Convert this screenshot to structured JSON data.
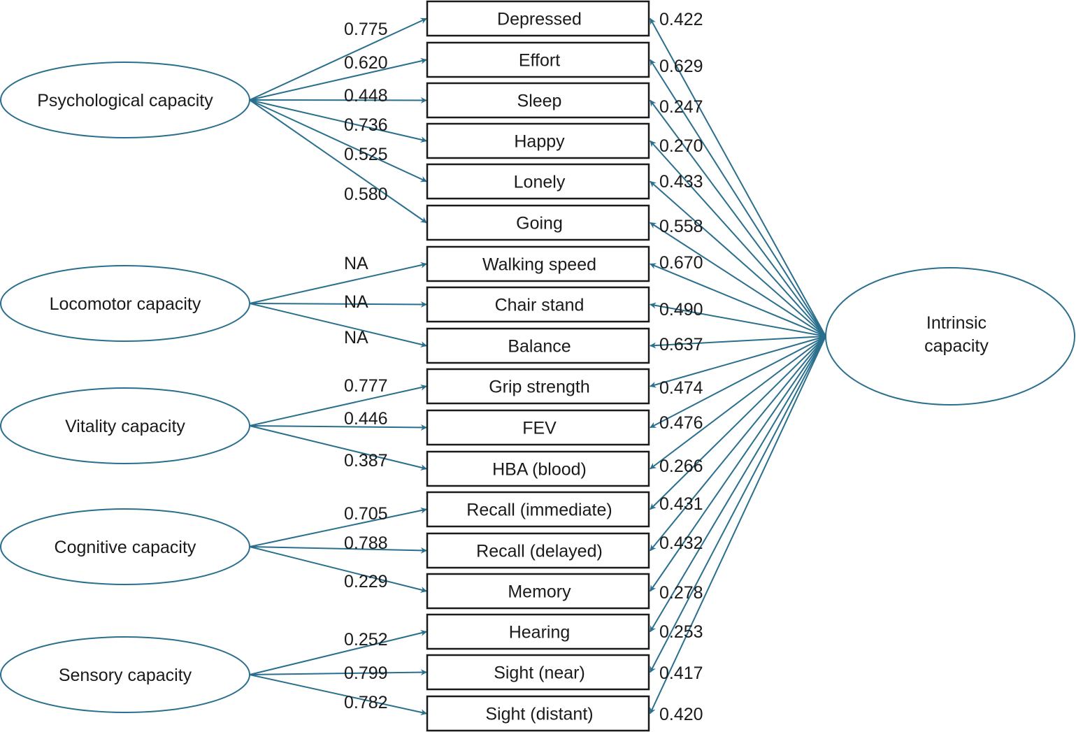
{
  "diagram": {
    "type": "structural-equation-model",
    "edge_color": "#2a6f8d",
    "latent_factors": [
      {
        "id": "psych",
        "label": "Psychological capacity"
      },
      {
        "id": "loco",
        "label": "Locomotor capacity"
      },
      {
        "id": "vital",
        "label": "Vitality capacity"
      },
      {
        "id": "cog",
        "label": "Cognitive capacity"
      },
      {
        "id": "sens",
        "label": "Sensory capacity"
      }
    ],
    "general_factor": {
      "label_line1": "Intrinsic",
      "label_line2": "capacity"
    },
    "indicators": [
      {
        "label": "Depressed",
        "factor": "psych",
        "domain_loading": "0.775",
        "general_loading": "0.422"
      },
      {
        "label": "Effort",
        "factor": "psych",
        "domain_loading": "0.620",
        "general_loading": "0.629"
      },
      {
        "label": "Sleep",
        "factor": "psych",
        "domain_loading": "0.448",
        "general_loading": "0.247"
      },
      {
        "label": "Happy",
        "factor": "psych",
        "domain_loading": "0.736",
        "general_loading": "0.270"
      },
      {
        "label": "Lonely",
        "factor": "psych",
        "domain_loading": "0.525",
        "general_loading": "0.433"
      },
      {
        "label": "Going",
        "factor": "psych",
        "domain_loading": "0.580",
        "general_loading": "0.558"
      },
      {
        "label": "Walking speed",
        "factor": "loco",
        "domain_loading": "NA",
        "general_loading": "0.670"
      },
      {
        "label": "Chair stand",
        "factor": "loco",
        "domain_loading": "NA",
        "general_loading": "0.490"
      },
      {
        "label": "Balance",
        "factor": "loco",
        "domain_loading": "NA",
        "general_loading": "0.637"
      },
      {
        "label": "Grip strength",
        "factor": "vital",
        "domain_loading": "0.777",
        "general_loading": "0.474"
      },
      {
        "label": "FEV",
        "factor": "vital",
        "domain_loading": "0.446",
        "general_loading": "0.476"
      },
      {
        "label": "HBA (blood)",
        "factor": "vital",
        "domain_loading": "0.387",
        "general_loading": "0.266"
      },
      {
        "label": "Recall (immediate)",
        "factor": "cog",
        "domain_loading": "0.705",
        "general_loading": "0.431"
      },
      {
        "label": "Recall (delayed)",
        "factor": "cog",
        "domain_loading": "0.788",
        "general_loading": "0.432"
      },
      {
        "label": "Memory",
        "factor": "cog",
        "domain_loading": "0.229",
        "general_loading": "0.278"
      },
      {
        "label": "Hearing",
        "factor": "sens",
        "domain_loading": "0.252",
        "general_loading": "0.253"
      },
      {
        "label": "Sight (near)",
        "factor": "sens",
        "domain_loading": "0.799",
        "general_loading": "0.417"
      },
      {
        "label": "Sight (distant)",
        "factor": "sens",
        "domain_loading": "0.782",
        "general_loading": "0.420"
      }
    ]
  }
}
